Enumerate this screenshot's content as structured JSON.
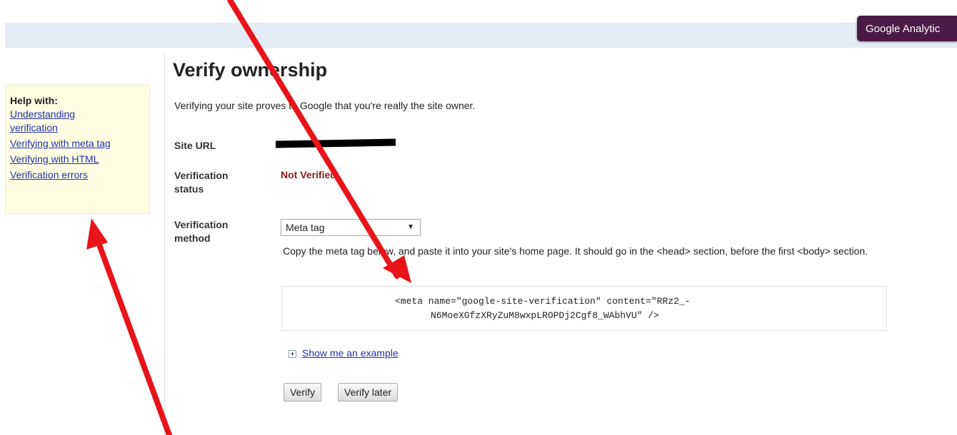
{
  "header": {
    "analytics_tab": "Google Analytic"
  },
  "help": {
    "title": "Help with:",
    "links": [
      {
        "label": "Understanding\nverification"
      },
      {
        "label": "Verifying with meta tag"
      },
      {
        "label": "Verifying with HTML"
      },
      {
        "label": "Verification errors"
      }
    ]
  },
  "main": {
    "title": "Verify ownership",
    "intro": "Verifying your site proves to Google that you're really the site owner.",
    "site_url_label": "Site URL",
    "status_label": "Verification status",
    "status_value": "Not Verified",
    "method_label": "Verification method",
    "method_selected": "Meta tag",
    "instructions": "Copy the meta tag below, and paste it into your site's home page. It should go in the <head> section, before the first <body> section.",
    "code_line1": "<meta name=\"google-site-verification\" content=\"RRz2_-",
    "code_line2": "N6MoeXGfzXRyZuM8wxpLROPDj2Cgf8_WAbhVU\" />",
    "show_example": "Show me an example",
    "verify_button": "Verify",
    "verify_later_button": "Verify later"
  },
  "colors": {
    "annotation_arrow": "#e8141a",
    "link": "#2232aa",
    "status": "#8b1a1a"
  }
}
